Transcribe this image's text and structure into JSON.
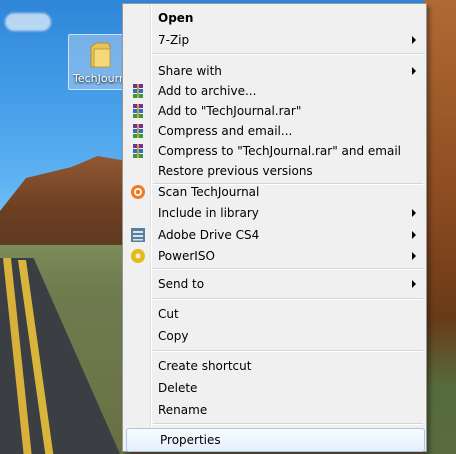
{
  "desktop": {
    "icon_label": "TechJournal"
  },
  "menu": {
    "items": [
      {
        "label": "Open",
        "bold": true
      },
      {
        "label": "7-Zip",
        "submenu": true
      },
      {
        "label": "Share with",
        "submenu": true
      },
      {
        "label": "Add to archive...",
        "icon": "winrar-icon"
      },
      {
        "label": "Add to \"TechJournal.rar\"",
        "icon": "winrar-icon"
      },
      {
        "label": "Compress and email...",
        "icon": "winrar-icon"
      },
      {
        "label": "Compress to \"TechJournal.rar\" and email",
        "icon": "winrar-icon"
      },
      {
        "label": "Restore previous versions"
      },
      {
        "label": "Scan TechJournal",
        "icon": "avast-icon"
      },
      {
        "label": "Include in library",
        "submenu": true
      },
      {
        "label": "Adobe Drive CS4",
        "submenu": true,
        "icon": "adobe-drive-icon"
      },
      {
        "label": "PowerISO",
        "submenu": true,
        "icon": "poweriso-icon"
      },
      {
        "label": "Send to",
        "submenu": true
      },
      {
        "label": "Cut"
      },
      {
        "label": "Copy"
      },
      {
        "label": "Create shortcut"
      },
      {
        "label": "Delete"
      },
      {
        "label": "Rename"
      },
      {
        "label": "Properties",
        "highlighted": true
      }
    ]
  }
}
